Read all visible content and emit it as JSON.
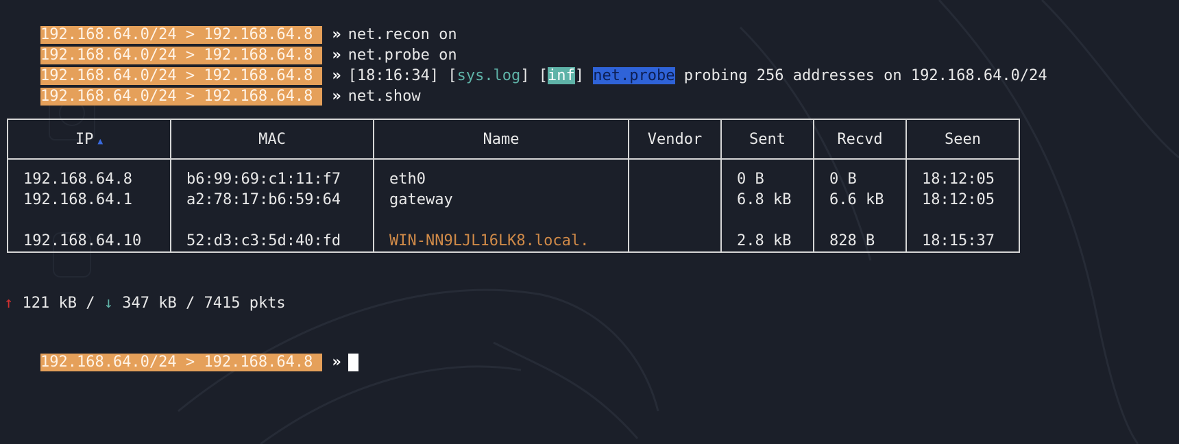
{
  "prompt": {
    "subnet": "192.168.64.0/24",
    "sep": ">",
    "host": "192.168.64.8",
    "chevron": "»"
  },
  "history": [
    {
      "text": "net.recon on"
    },
    {
      "text": "net.probe on"
    },
    {
      "log": {
        "time": "[18:16:34]",
        "open": "[",
        "syslog": "sys.log",
        "close": "]",
        "bopen": "[",
        "level": "inf",
        "bclose": "]",
        "module": "net.probe",
        "message": "probing 256 addresses on 192.168.64.0/24"
      }
    },
    {
      "text": "net.show"
    }
  ],
  "table": {
    "headers": {
      "ip": "IP",
      "sort_arrow": "▲",
      "mac": "MAC",
      "name": "Name",
      "vendor": "Vendor",
      "sent": "Sent",
      "recvd": "Recvd",
      "seen": "Seen"
    },
    "rows": [
      {
        "ip": "192.168.64.8",
        "mac": "b6:99:69:c1:11:f7",
        "name": "eth0",
        "vendor": "",
        "sent": "0 B",
        "recvd": "0 B",
        "seen": "18:12:05"
      },
      {
        "ip": "192.168.64.1",
        "mac": "a2:78:17:b6:59:64",
        "name": "gateway",
        "vendor": "",
        "sent": "6.8 kB",
        "recvd": "6.6 kB",
        "seen": "18:12:05"
      },
      {
        "ip": "192.168.64.10",
        "mac": "52:d3:c3:5d:40:fd",
        "name": "WIN-NN9LJL16LK8.local.",
        "vendor": "",
        "sent": "2.8 kB",
        "recvd": "828 B",
        "seen": "18:15:37"
      }
    ]
  },
  "stats": {
    "up_icon": "↑",
    "up": "121 kB",
    "slash1": "/",
    "down_icon": "↓",
    "down": "347 kB",
    "slash2": "/",
    "pkts": "7415 pkts"
  },
  "colors": {
    "prompt_bg": "#e5a05a",
    "teal": "#5fb3a8",
    "module_bg": "#2f63d8",
    "orange_text": "#d08a48",
    "background": "#1b1f29"
  },
  "icons": [
    "upload-arrow-icon",
    "download-arrow-icon",
    "sort-ascending-icon",
    "text-cursor-icon"
  ]
}
